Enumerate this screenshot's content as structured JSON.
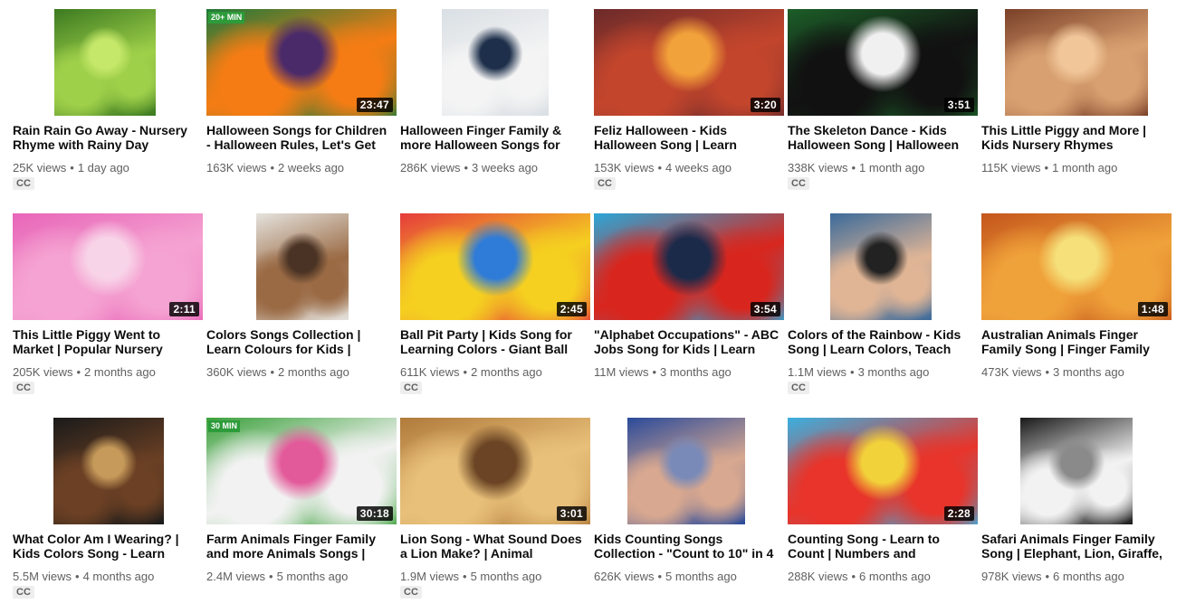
{
  "videos": [
    {
      "title": "Rain Rain Go Away - Nursery Rhyme with Rainy Day",
      "views": "25K views",
      "age": "1 day ago",
      "cc": "CC",
      "duration": "",
      "thumb": {
        "layout": "narrow",
        "colors": [
          "#3c7a20",
          "#9fd04a",
          "#c6e86a"
        ]
      }
    },
    {
      "title": "Halloween Songs for Children - Halloween Rules, Let's Get",
      "views": "163K views",
      "age": "2 weeks ago",
      "cc": "",
      "duration": "23:47",
      "badge": "20+ MIN",
      "thumb": {
        "layout": "full",
        "colors": [
          "#1f7a3a",
          "#f57c14",
          "#4b2a6a"
        ]
      }
    },
    {
      "title": "Halloween Finger Family & more Halloween Songs for",
      "views": "286K views",
      "age": "3 weeks ago",
      "cc": "",
      "duration": "",
      "thumb": {
        "layout": "narrow",
        "colors": [
          "#d9dfe4",
          "#f4f4f4",
          "#1d2f4a"
        ]
      }
    },
    {
      "title": "Feliz Halloween - Kids Halloween Song | Learn",
      "views": "153K views",
      "age": "4 weeks ago",
      "cc": "CC",
      "duration": "3:20",
      "thumb": {
        "layout": "full",
        "colors": [
          "#6b2a2a",
          "#c2452c",
          "#f2a23a"
        ]
      }
    },
    {
      "title": "The Skeleton Dance - Kids Halloween Song | Halloween",
      "views": "338K views",
      "age": "1 month ago",
      "cc": "CC",
      "duration": "3:51",
      "thumb": {
        "layout": "full",
        "colors": [
          "#1c5e28",
          "#111111",
          "#f0f0f0"
        ]
      }
    },
    {
      "title": "This Little Piggy and More | Kids Nursery Rhymes",
      "views": "115K views",
      "age": "1 month ago",
      "cc": "",
      "duration": "",
      "thumb": {
        "layout": "narrow",
        "colors": [
          "#7a4028",
          "#d8a070",
          "#f1c79a"
        ]
      }
    },
    {
      "title": "This Little Piggy Went to Market | Popular Nursery",
      "views": "205K views",
      "age": "2 months ago",
      "cc": "CC",
      "duration": "2:11",
      "thumb": {
        "layout": "full",
        "colors": [
          "#e865b8",
          "#f5a3d2",
          "#f8d4e8"
        ]
      }
    },
    {
      "title": "Colors Songs Collection | Learn Colours for Kids |",
      "views": "360K views",
      "age": "2 months ago",
      "cc": "",
      "duration": "",
      "thumb": {
        "layout": "narrow",
        "colors": [
          "#e5e3de",
          "#9a6a44",
          "#4a3324"
        ]
      }
    },
    {
      "title": "Ball Pit Party | Kids Song for Learning Colors - Giant Ball",
      "views": "611K views",
      "age": "2 months ago",
      "cc": "CC",
      "duration": "2:45",
      "thumb": {
        "layout": "full",
        "colors": [
          "#e53b3b",
          "#f5d020",
          "#2f7bd8"
        ]
      }
    },
    {
      "title": "\"Alphabet Occupations\" - ABC Jobs Song for Kids | Learn",
      "views": "11M views",
      "age": "3 months ago",
      "cc": "",
      "duration": "3:54",
      "thumb": {
        "layout": "full",
        "colors": [
          "#2aa7d8",
          "#d8261e",
          "#1c2a4a"
        ]
      }
    },
    {
      "title": "Colors of the Rainbow - Kids Song | Learn Colors, Teach",
      "views": "1.1M views",
      "age": "3 months ago",
      "cc": "CC",
      "duration": "",
      "thumb": {
        "layout": "narrow",
        "colors": [
          "#3b6a9a",
          "#e0b596",
          "#222222"
        ]
      }
    },
    {
      "title": "Australian Animals Finger Family Song | Finger Family",
      "views": "473K views",
      "age": "3 months ago",
      "cc": "",
      "duration": "1:48",
      "thumb": {
        "layout": "full",
        "colors": [
          "#c4561c",
          "#f0a23a",
          "#f5e07a"
        ]
      }
    },
    {
      "title": "What Color Am I Wearing? | Kids Colors Song - Learn",
      "views": "5.5M views",
      "age": "4 months ago",
      "cc": "CC",
      "duration": "",
      "thumb": {
        "layout": "narrow",
        "colors": [
          "#1a1a1a",
          "#6b4024",
          "#c69a5a"
        ]
      }
    },
    {
      "title": "Farm Animals Finger Family and more Animals Songs |",
      "views": "2.4M views",
      "age": "5 months ago",
      "cc": "",
      "duration": "30:18",
      "badge": "30 MIN",
      "thumb": {
        "layout": "full",
        "colors": [
          "#3aa03a",
          "#f2f2f2",
          "#e35a9a"
        ]
      }
    },
    {
      "title": "Lion Song - What Sound Does a Lion Make? | Animal",
      "views": "1.9M views",
      "age": "5 months ago",
      "cc": "CC",
      "duration": "3:01",
      "thumb": {
        "layout": "full",
        "colors": [
          "#b07a3a",
          "#e8c07a",
          "#6a4424"
        ]
      }
    },
    {
      "title": "Kids Counting Songs Collection - \"Count to 10\" in 4",
      "views": "626K views",
      "age": "5 months ago",
      "cc": "",
      "duration": "",
      "thumb": {
        "layout": "narrow",
        "colors": [
          "#2a4a9a",
          "#d8a890",
          "#7a8ab8"
        ]
      }
    },
    {
      "title": "Counting Song - Learn to Count | Numbers and",
      "views": "288K views",
      "age": "6 months ago",
      "cc": "",
      "duration": "2:28",
      "thumb": {
        "layout": "full",
        "colors": [
          "#3ab0e0",
          "#e8342a",
          "#f2d23a"
        ]
      }
    },
    {
      "title": "Safari Animals Finger Family Song | Elephant, Lion, Giraffe,",
      "views": "978K views",
      "age": "6 months ago",
      "cc": "",
      "duration": "",
      "thumb": {
        "layout": "narrow",
        "colors": [
          "#1a1a1a",
          "#f2f2f2",
          "#8a8a8a"
        ]
      }
    }
  ],
  "separator": "•"
}
